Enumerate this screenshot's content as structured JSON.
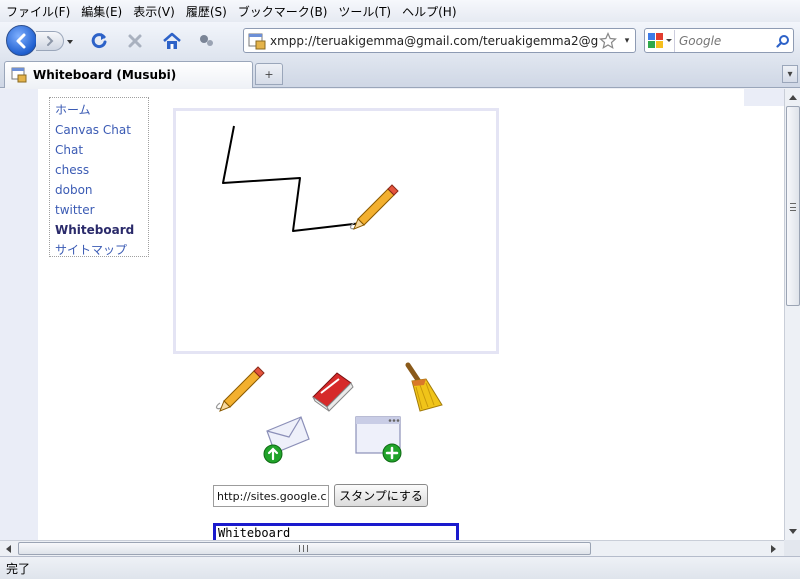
{
  "menubar": {
    "items": [
      "ファイル(F)",
      "編集(E)",
      "表示(V)",
      "履歴(S)",
      "ブックマーク(B)",
      "ツール(T)",
      "ヘルプ(H)"
    ]
  },
  "navbar": {
    "url": "xmpp://teruakigemma@gmail.com/teruakigemma2@g",
    "search_placeholder": "Google"
  },
  "tab": {
    "title": "Whiteboard (Musubi)",
    "new_tab_glyph": "+"
  },
  "site_nav": {
    "items": [
      {
        "label": "ホーム"
      },
      {
        "label": "Canvas Chat"
      },
      {
        "label": "Chat"
      },
      {
        "label": "chess"
      },
      {
        "label": "dobon"
      },
      {
        "label": "twitter"
      },
      {
        "label": "Whiteboard",
        "current": true
      },
      {
        "label": "サイトマップ"
      }
    ]
  },
  "whiteboard": {
    "icons": [
      "pencil-cursor-icon"
    ],
    "tools": [
      "pencil-icon",
      "eraser-icon",
      "broom-icon",
      "send-mail-icon",
      "new-window-icon"
    ]
  },
  "stamp": {
    "url_value": "http://sites.google.c",
    "button_label": "スタンプにする"
  },
  "chat": {
    "title": "Whiteboard"
  },
  "status": {
    "text": "完了"
  },
  "colors": {
    "link": "#3b5bb4",
    "canvas_border": "#e4e4f4",
    "chat_border": "#1a1acd"
  }
}
